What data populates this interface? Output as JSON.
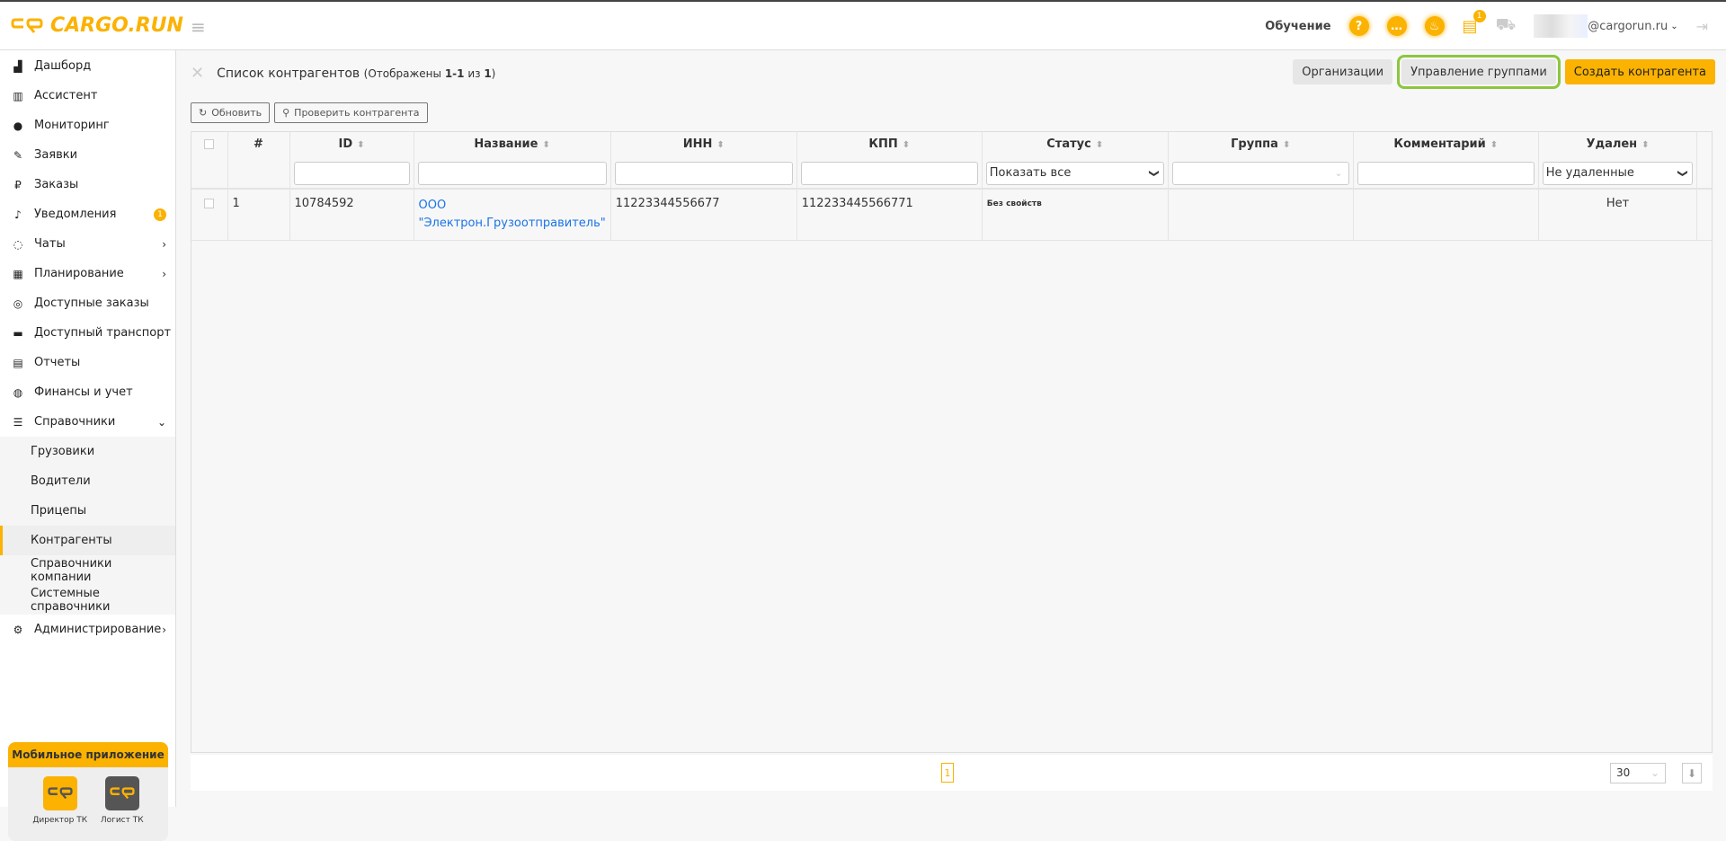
{
  "header": {
    "logo": "CARGO.RUN",
    "training": "Обучение",
    "help_icon": "?",
    "notif_badge": "1",
    "email": "@cargorun.ru"
  },
  "sidebar": {
    "items": [
      {
        "label": "Дашборд",
        "icon": "▟"
      },
      {
        "label": "Ассистент",
        "icon": "▥"
      },
      {
        "label": "Мониторинг",
        "icon": "●"
      },
      {
        "label": "Заявки",
        "icon": "✎"
      },
      {
        "label": "Заказы",
        "icon": "₽"
      },
      {
        "label": "Уведомления",
        "icon": "♪",
        "badge": "1"
      },
      {
        "label": "Чаты",
        "icon": "◌",
        "chev": "›"
      },
      {
        "label": "Планирование",
        "icon": "▦",
        "chev": "›"
      },
      {
        "label": "Доступные заказы",
        "icon": "◎"
      },
      {
        "label": "Доступный транспорт",
        "icon": "▬"
      },
      {
        "label": "Отчеты",
        "icon": "▤"
      },
      {
        "label": "Финансы и учет",
        "icon": "◍"
      },
      {
        "label": "Справочники",
        "icon": "☰",
        "chev": "⌄"
      }
    ],
    "sub": [
      "Грузовики",
      "Водители",
      "Прицепы",
      "Контрагенты",
      "Справочники компании",
      "Системные справочники"
    ],
    "admin": {
      "label": "Администрирование",
      "icon": "⚙",
      "chev": "›"
    },
    "mobile": {
      "title": "Мобильное приложение",
      "apps": [
        "Директор ТК",
        "Логист ТК"
      ]
    }
  },
  "main": {
    "title": "Список контрагентов",
    "shown_prefix": "(Отображены ",
    "shown_range": "1-1",
    "shown_of": " из ",
    "shown_total": "1",
    "shown_suffix": ")",
    "buttons": {
      "orgs": "Организации",
      "groups": "Управление группами",
      "create": "Создать контрагента",
      "refresh": "Обновить",
      "check": "Проверить контрагента"
    },
    "columns": [
      "#",
      "ID",
      "Название",
      "ИНН",
      "КПП",
      "Статус",
      "Группа",
      "Комментарий",
      "Удален"
    ],
    "filters": {
      "status": "Показать все",
      "deleted": "Не удаленные"
    },
    "rows": [
      {
        "num": "1",
        "id": "10784592",
        "name1": "ООО",
        "name2": "\"Электрон.Грузоотправитель\"",
        "inn": "11223344556677",
        "kpp": "112233445566771",
        "status": "Без свойств",
        "group": "",
        "comment": "",
        "deleted": "Нет"
      }
    ],
    "pagination": {
      "page": "1",
      "per_page": "30"
    }
  }
}
